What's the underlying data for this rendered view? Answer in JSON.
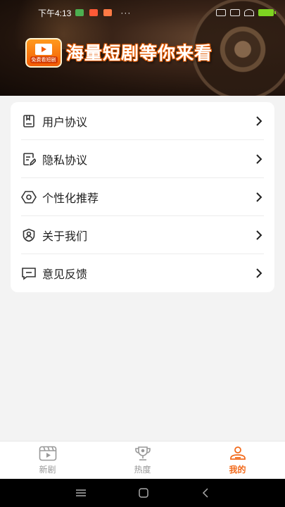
{
  "status_bar": {
    "time": "下午4:13",
    "dots": "···",
    "battery_color": "#7ed321"
  },
  "banner": {
    "logo_text": "免费看短剧",
    "title": "海量短剧等你来看",
    "accent": "#f25c05"
  },
  "menu": {
    "items": [
      {
        "label": "用户协议",
        "icon": "document-icon"
      },
      {
        "label": "隐私协议",
        "icon": "edit-document-icon"
      },
      {
        "label": "个性化推荐",
        "icon": "settings-gear-icon"
      },
      {
        "label": "关于我们",
        "icon": "shield-user-icon"
      },
      {
        "label": "意见反馈",
        "icon": "feedback-message-icon"
      }
    ]
  },
  "bottom_nav": {
    "items": [
      {
        "label": "新剧",
        "icon": "film-icon",
        "active": false
      },
      {
        "label": "热度",
        "icon": "trophy-icon",
        "active": false
      },
      {
        "label": "我的",
        "icon": "profile-icon",
        "active": true
      }
    ],
    "active_color": "#f26a1b"
  },
  "system_nav": {
    "buttons": [
      "menu-icon",
      "home-icon",
      "back-icon"
    ]
  }
}
